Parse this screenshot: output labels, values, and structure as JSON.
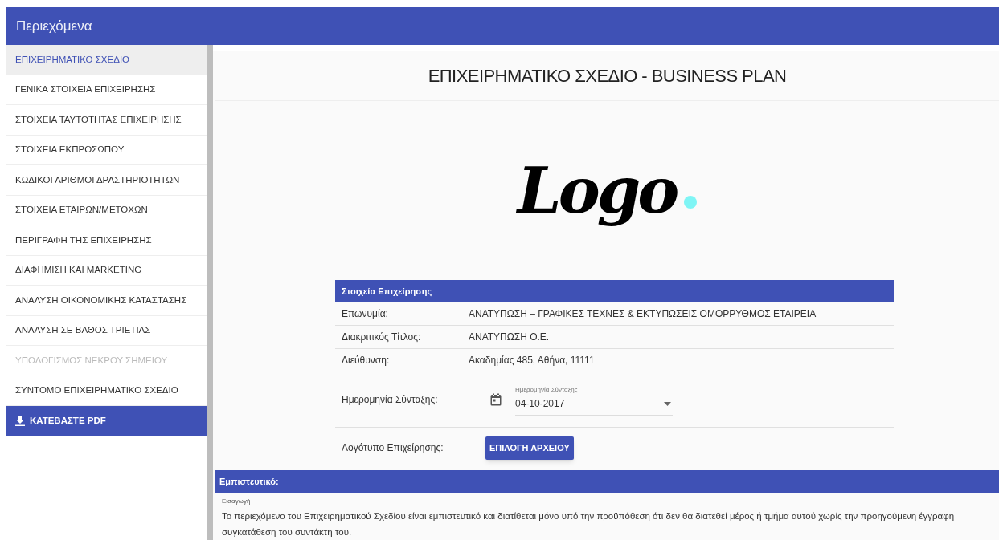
{
  "header": {
    "title": "Περιεχόμενα"
  },
  "sidebar": {
    "items": [
      {
        "label": "ΕΠΙΧΕΙΡΗΜΑΤΙΚΟ ΣΧΕΔΙΟ",
        "selected": true,
        "disabled": false
      },
      {
        "label": "ΓΕΝΙΚΑ ΣΤΟΙΧΕΙΑ ΕΠΙΧΕΙΡΗΣΗΣ",
        "selected": false,
        "disabled": false
      },
      {
        "label": "ΣΤΟΙΧΕΙΑ ΤΑΥΤΟΤΗΤΑΣ ΕΠΙΧΕΙΡΗΣΗΣ",
        "selected": false,
        "disabled": false
      },
      {
        "label": "ΣΤΟΙΧΕΙΑ ΕΚΠΡΟΣΩΠΟΥ",
        "selected": false,
        "disabled": false
      },
      {
        "label": "ΚΩΔΙΚΟΙ ΑΡΙΘΜΟΙ ΔΡΑΣΤΗΡΙΟΤΗΤΩΝ",
        "selected": false,
        "disabled": false
      },
      {
        "label": "ΣΤΟΙΧΕΙΑ ΕΤΑΙΡΩΝ/ΜΕΤΟΧΩΝ",
        "selected": false,
        "disabled": false
      },
      {
        "label": "ΠΕΡΙΓΡΑΦΗ ΤΗΣ ΕΠΙΧΕΙΡΗΣΗΣ",
        "selected": false,
        "disabled": false
      },
      {
        "label": "ΔΙΑΦΗΜΙΣΗ ΚΑΙ MARKETING",
        "selected": false,
        "disabled": false
      },
      {
        "label": "ΑΝΑΛΥΣΗ ΟΙΚΟΝΟΜΙΚΗΣ ΚΑΤΑΣΤΑΣΗΣ",
        "selected": false,
        "disabled": false
      },
      {
        "label": "ΑΝΑΛΥΣΗ ΣΕ ΒΑΘΟΣ ΤΡΙΕΤΙΑΣ",
        "selected": false,
        "disabled": false
      },
      {
        "label": "ΥΠΟΛΟΓΙΣΜΟΣ ΝΕΚΡΟΥ ΣΗΜΕΙΟΥ",
        "selected": false,
        "disabled": true
      },
      {
        "label": "ΣΥΝΤΟΜΟ ΕΠΙΧΕΙΡΗΜΑΤΙΚΟ ΣΧΕΔΙΟ",
        "selected": false,
        "disabled": false
      }
    ],
    "download_button": "ΚΑΤΕΒΑΣΤΕ PDF"
  },
  "main": {
    "title": "ΕΠΙΧΕΙΡΗΜΑΤΙΚΟ ΣΧΕΔΙΟ - BUSINESS PLAN",
    "logo_text": "Logo",
    "company_table": {
      "header": "Στοιχεία Επιχείρησης",
      "rows": [
        {
          "kind": "text",
          "label": "Επωνυμία:",
          "value": "ΑΝΑΤΥΠΩΣΗ – ΓΡΑΦΙΚΕΣ ΤΕΧΝΕΣ & ΕΚΤΥΠΩΣΕΙΣ ΟΜΟΡΡΥΘΜΟΣ ΕΤΑΙΡΕΙΑ"
        },
        {
          "kind": "text",
          "label": "Διακριτικός Τίτλος:",
          "value": "ΑΝΑΤΥΠΩΣΗ Ο.Ε."
        },
        {
          "kind": "text",
          "label": "Διεύθυνση:",
          "value": "Ακαδημίας 485, Αθήνα, 11111"
        },
        {
          "kind": "date",
          "label": "Ημερομηνία Σύνταξης:",
          "field_label": "Ημερομηνία Σύνταξης",
          "value": "04-10-2017"
        },
        {
          "kind": "file",
          "label": "Λογότυπο Επιχείρησης:",
          "button": "ΕΠΙΛΟΓΗ ΑΡΧΕΙΟΥ"
        }
      ]
    },
    "confidential": {
      "header": "Εμπιστευτικό:",
      "field_label": "Εισαγωγή",
      "text": "Το περιεχόμενο του Επιχειρηματικού Σχεδίου είναι εμπιστευτικό και διατίθεται μόνο υπό την προϋπόθεση ότι δεν θα διατεθεί μέρος ή τμήμα αυτού χωρίς την προηγούμενη έγγραφη συγκατάθεση του συντάκτη του."
    }
  }
}
